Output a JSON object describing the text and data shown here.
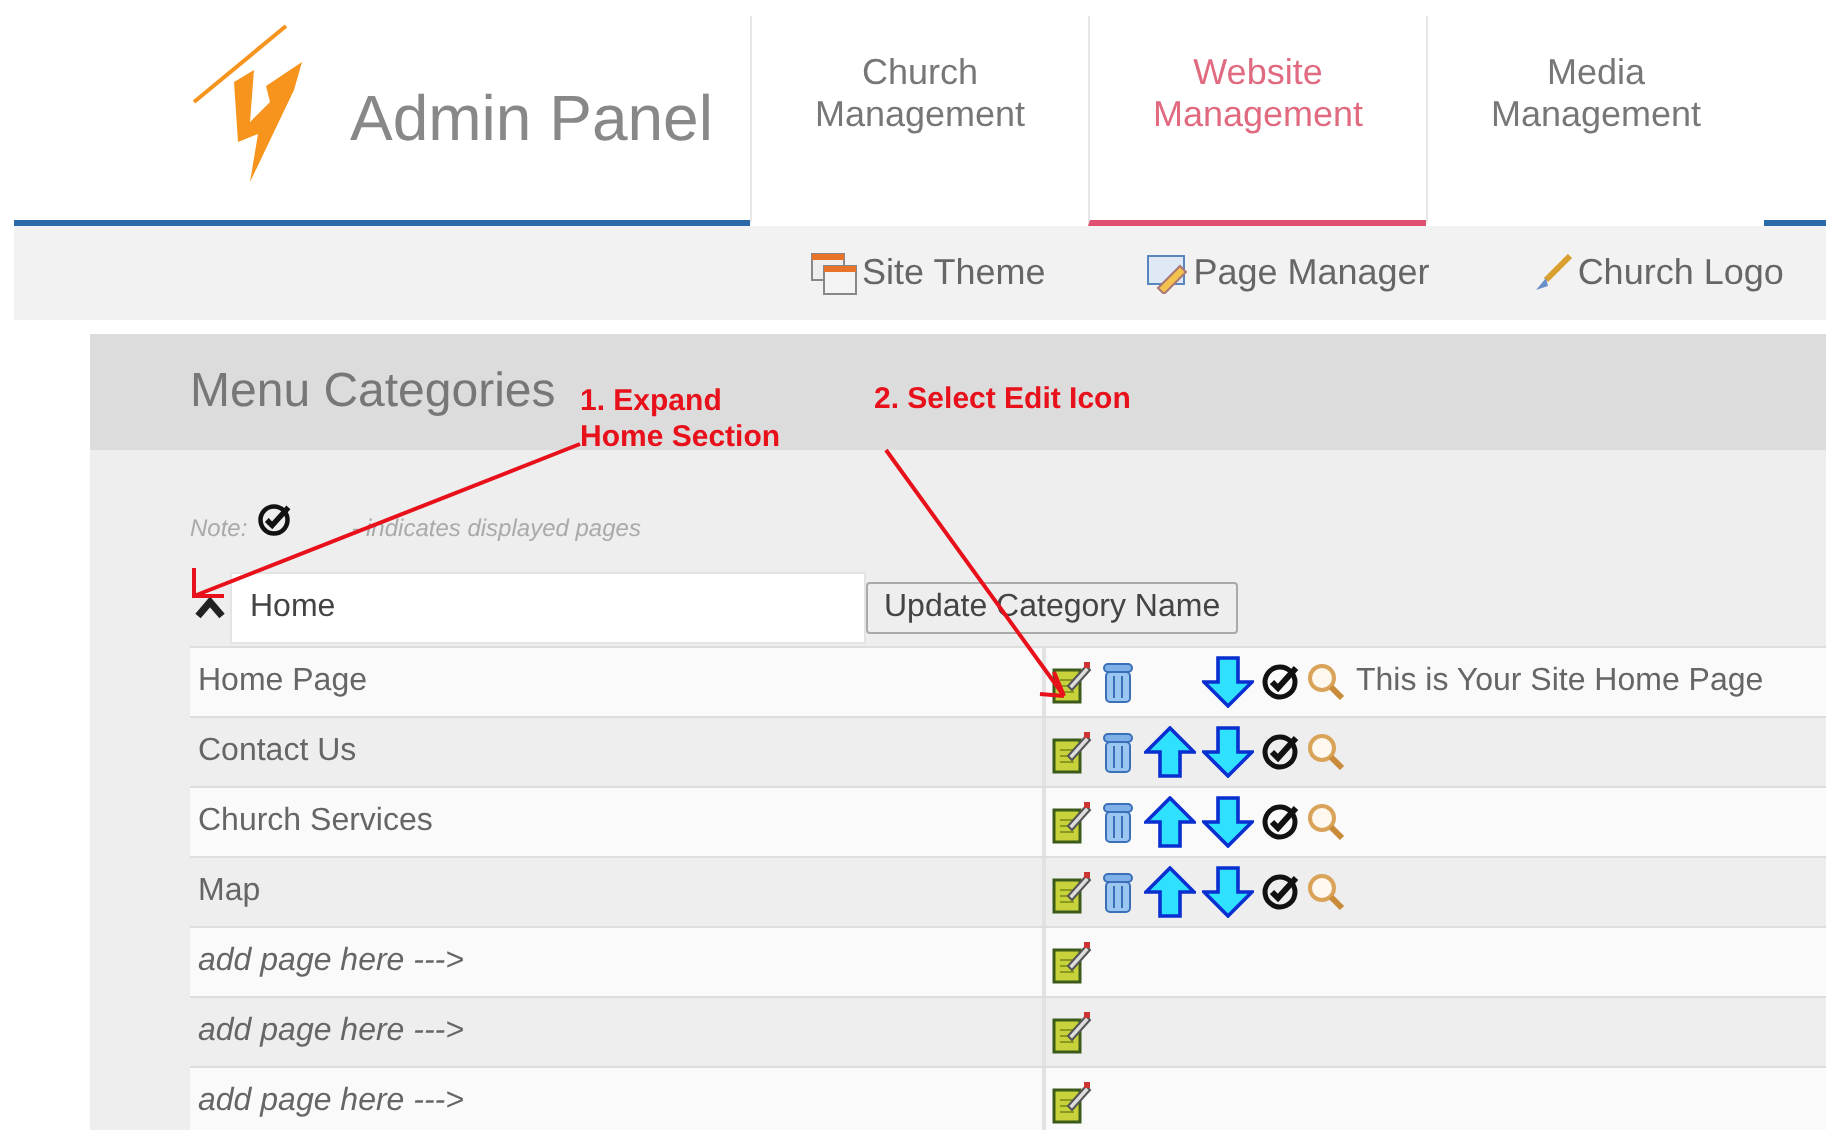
{
  "header": {
    "title": "Admin Panel"
  },
  "tabs": [
    {
      "label": "Church Management",
      "selected": false
    },
    {
      "label": "Website Management",
      "selected": true
    },
    {
      "label": "Media Management",
      "selected": false
    }
  ],
  "subnav": [
    {
      "label": "Site Theme",
      "kind": "theme"
    },
    {
      "label": "Page Manager",
      "kind": "pages"
    },
    {
      "label": "Church Logo",
      "kind": "logo"
    }
  ],
  "panel": {
    "title": "Menu Categories",
    "note_label": "Note:",
    "note_text": "- indicates displayed pages",
    "category": {
      "expanded": true,
      "value": "Home",
      "button": "Update Category Name"
    },
    "rows": [
      {
        "kind": "page",
        "name": "Home Page",
        "move_up": false,
        "info": "This is Your Site Home Page"
      },
      {
        "kind": "page",
        "name": "Contact Us",
        "move_up": true
      },
      {
        "kind": "page",
        "name": "Church Services",
        "move_up": true
      },
      {
        "kind": "page",
        "name": "Map",
        "move_up": true
      },
      {
        "kind": "slot",
        "name": "add page here --->"
      },
      {
        "kind": "slot",
        "name": "add page here --->"
      },
      {
        "kind": "slot",
        "name": "add page here --->"
      }
    ]
  },
  "annotations": [
    {
      "kind": "expand",
      "text": "1. Expand\nHome Section"
    },
    {
      "kind": "edit",
      "text": "2. Select Edit Icon"
    }
  ]
}
